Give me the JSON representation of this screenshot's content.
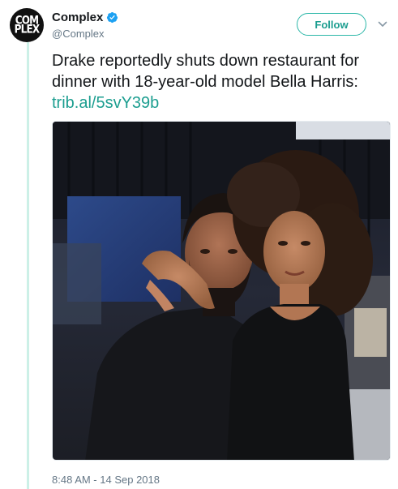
{
  "account": {
    "avatar_line1": "COM",
    "avatar_line2": "PLEX",
    "display_name": "Complex",
    "handle": "@Complex",
    "verified": true
  },
  "follow_label": "Follow",
  "tweet": {
    "text": "Drake reportedly shuts down restaurant for dinner with 18-year-old model Bella Harris: ",
    "link": "trib.al/5svY39b",
    "timestamp": "8:48 AM - 14 Sep 2018"
  },
  "media": {
    "description_icon": "photo"
  },
  "colors": {
    "accent": "#1c9e90",
    "thread_line": "#ccf0e7",
    "verified_badge": "#1da1f2"
  }
}
